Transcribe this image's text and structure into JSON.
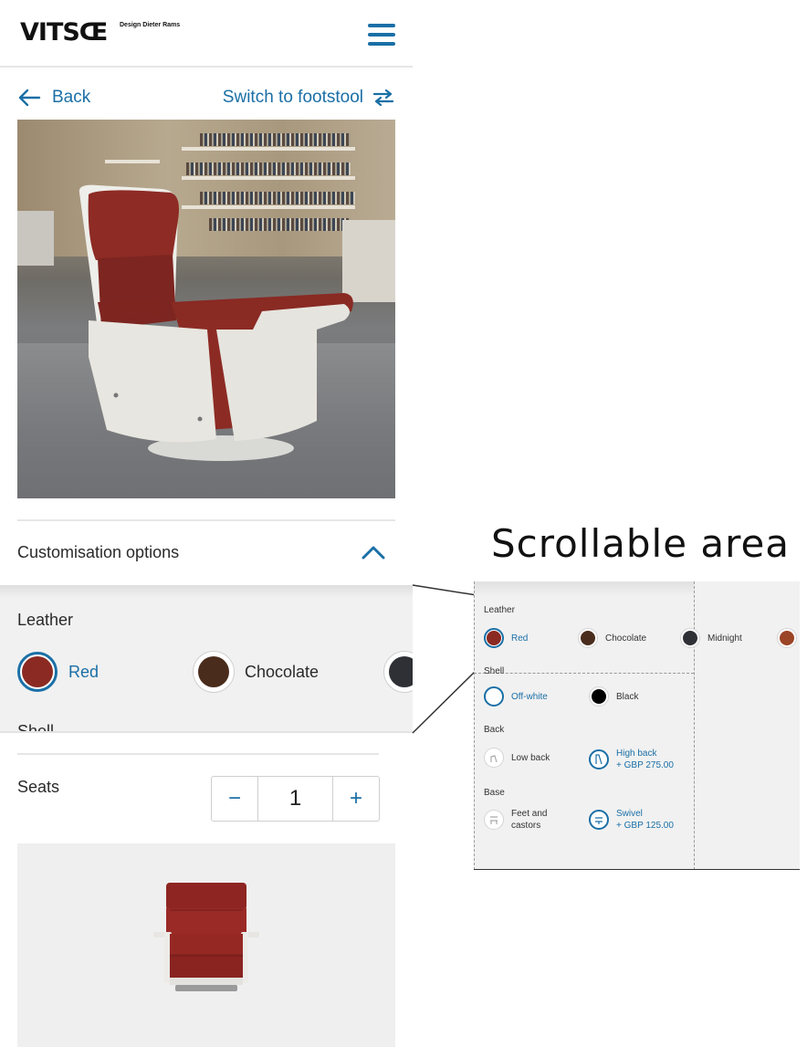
{
  "header": {
    "logo": "VITSŒ",
    "logo_sub": "Design Dieter Rams"
  },
  "nav": {
    "back_label": "Back",
    "switch_label": "Switch to footstool"
  },
  "customisation": {
    "title": "Customisation options",
    "leather_label": "Leather",
    "swatches": [
      {
        "label": "Red",
        "color": "#8b2a22",
        "selected": true
      },
      {
        "label": "Chocolate",
        "color": "#4a2c1c",
        "selected": false
      },
      {
        "label": "",
        "color": "#2f3036",
        "selected": false
      }
    ],
    "shell_partial": "Shell"
  },
  "seats": {
    "label": "Seats",
    "minus": "−",
    "value": "1",
    "plus": "+"
  },
  "callout": {
    "title": "Scrollable area",
    "leather_label": "Leather",
    "leather_options": [
      {
        "label": "Red",
        "color": "#8b2a22",
        "selected": true
      },
      {
        "label": "Chocolate",
        "color": "#4a2c1c",
        "selected": false
      },
      {
        "label": "Midnight",
        "color": "#2f3036",
        "selected": false
      },
      {
        "label": "",
        "color": "#9b4426",
        "selected": false
      }
    ],
    "shell_label": "Shell",
    "shell_options": [
      {
        "label": "Off-white",
        "color": "#ffffff",
        "selected": true
      },
      {
        "label": "Black",
        "color": "#000000",
        "selected": false
      }
    ],
    "back_label": "Back",
    "back_options": [
      {
        "label": "Low back",
        "price": "",
        "selected": false
      },
      {
        "label": "High back",
        "price": "+ GBP 275.00",
        "selected": true
      }
    ],
    "base_label": "Base",
    "base_options": [
      {
        "label_line1": "Feet and",
        "label_line2": "castors",
        "selected": false
      },
      {
        "label_line1": "Swivel",
        "label_line2": "+ GBP 125.00",
        "selected": true
      }
    ]
  },
  "colors": {
    "accent": "#1a6fa6",
    "leather_red": "#8b2a22",
    "panel_bg": "#f1f1f1"
  }
}
